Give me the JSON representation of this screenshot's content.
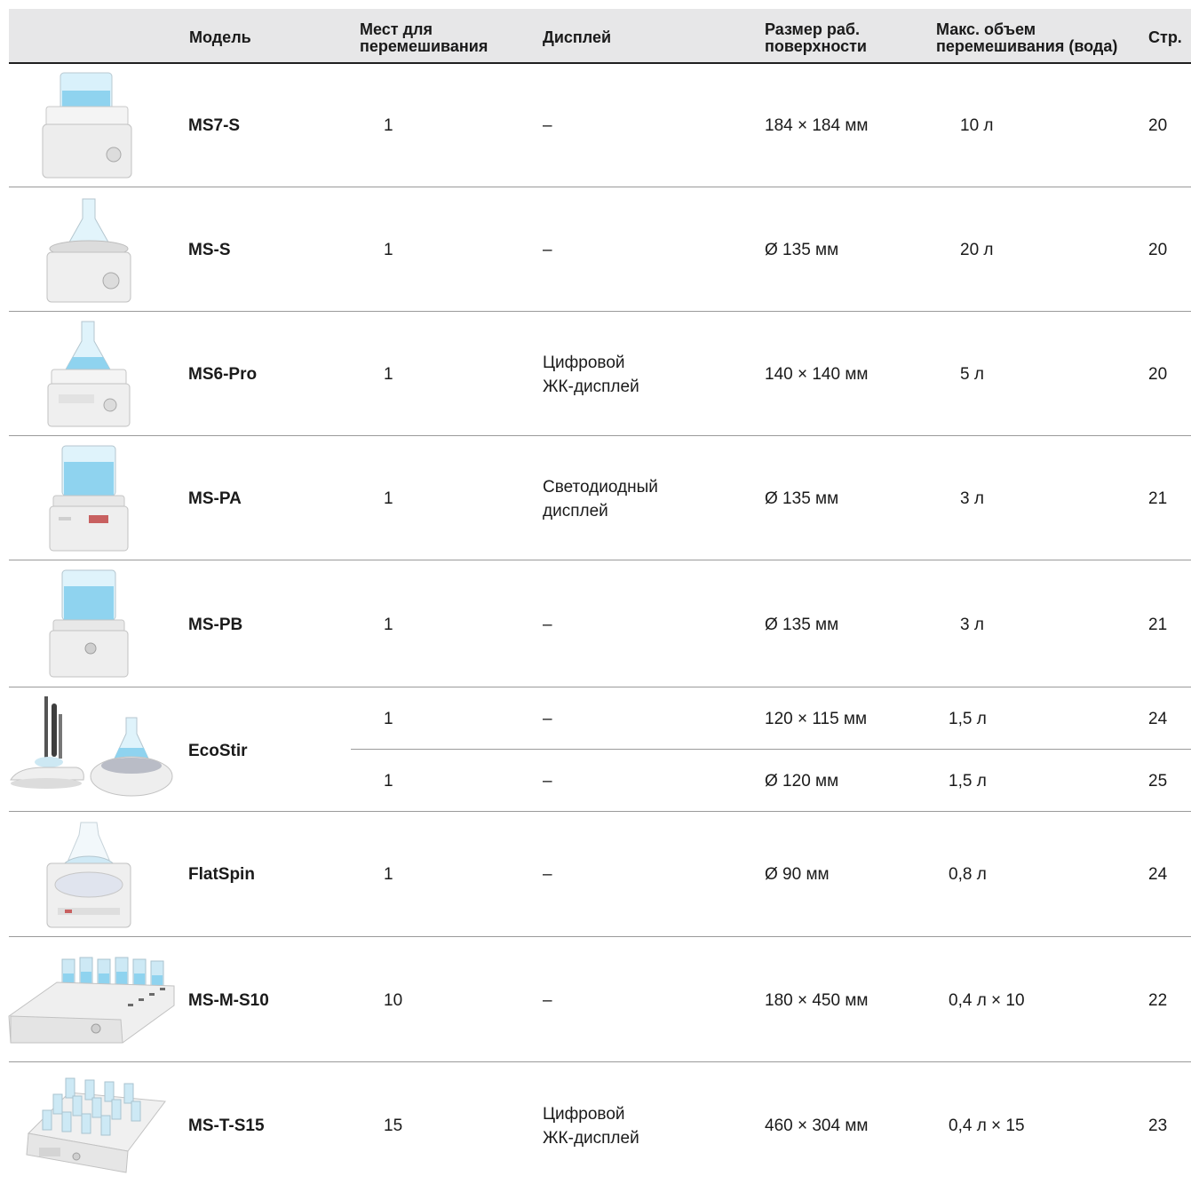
{
  "header": {
    "model": "Модель",
    "places": [
      "Мест для",
      "перемешивания"
    ],
    "display": "Дисплей",
    "surface": [
      "Размер раб.",
      "поверхности"
    ],
    "volume": [
      "Макс. объем",
      "перемешивания (вода)"
    ],
    "page": "Стр."
  },
  "rows": [
    {
      "model": "MS7-S",
      "places": "1",
      "display": [
        "–",
        ""
      ],
      "surface": "184 × 184 мм",
      "volume": "10 л",
      "page": "20",
      "image": "MS7-S stirrer image"
    },
    {
      "model": "MS-S",
      "places": "1",
      "display": [
        "–",
        ""
      ],
      "surface": "Ø 135 мм",
      "volume": "20 л",
      "page": "20",
      "image": "MS-S stirrer image"
    },
    {
      "model": "MS6-Pro",
      "places": "1",
      "display": [
        "Цифровой",
        "ЖК-дисплей"
      ],
      "surface": "140 × 140 мм",
      "volume": "5 л",
      "page": "20",
      "image": "MS6-Pro stirrer image"
    },
    {
      "model": "MS-PA",
      "places": "1",
      "display": [
        "Светодиодный",
        "дисплей"
      ],
      "surface": "Ø 135 мм",
      "volume": "3 л",
      "page": "21",
      "image": "MS-PA stirrer image"
    },
    {
      "model": "MS-PB",
      "places": "1",
      "display": [
        "–",
        ""
      ],
      "surface": "Ø 135 мм",
      "volume": "3 л",
      "page": "21",
      "image": "MS-PB stirrer image"
    }
  ],
  "ecostir": {
    "model": "EcoStir",
    "image": "EcoStir stirrers image",
    "sub": [
      {
        "places": "1",
        "display": "–",
        "surface": "120 × 115 мм",
        "volume": "1,5 л",
        "page": "24"
      },
      {
        "places": "1",
        "display": "–",
        "surface": "Ø 120 мм",
        "volume": "1,5 л",
        "page": "25"
      }
    ]
  },
  "rows2": [
    {
      "model": "FlatSpin",
      "places": "1",
      "display": [
        "–",
        ""
      ],
      "surface": "Ø 90 мм",
      "volume": "0,8 л",
      "page": "24",
      "image": "FlatSpin stirrer image"
    },
    {
      "model": "MS-M-S10",
      "places": "10",
      "display": [
        "–",
        ""
      ],
      "surface": "180 × 450 мм",
      "volume": "0,4 л × 10",
      "page": "22",
      "image": "MS-M-S10 multi-position stirrer image"
    },
    {
      "model": "MS-T-S15",
      "places": "15",
      "display": [
        "Цифровой",
        "ЖК-дисплей"
      ],
      "surface": "460 × 304 мм",
      "volume": "0,4 л × 15",
      "page": "23",
      "image": "MS-T-S15 multi-position stirrer image"
    }
  ],
  "colors": {
    "header_bg": "#e7e7e8",
    "liquid": "#8fd3ef",
    "device": "#f1f1f1"
  }
}
